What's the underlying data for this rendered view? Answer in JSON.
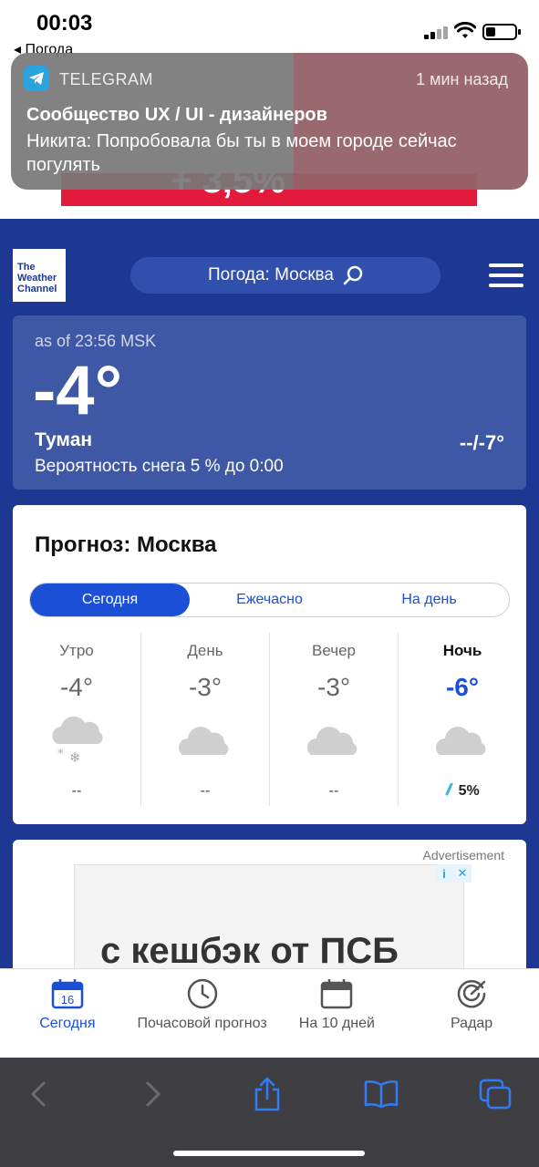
{
  "status_bar": {
    "time": "00:03",
    "back_label": "◂ Погода"
  },
  "notification": {
    "app": "TELEGRAM",
    "time_ago": "1 мин назад",
    "title": "Сообщество UX / UI - дизайнеров",
    "body": "Никита: Попробовала бы ты в моем городе сейчас погулять"
  },
  "top_ad": {
    "text": "+ 3,5%"
  },
  "header": {
    "logo_text": "The Weather Channel",
    "search_label": "Погода: Москва"
  },
  "current": {
    "as_of": "as of 23:56 MSK",
    "temperature": "-4°",
    "condition": "Туман",
    "precip_chance": "Вероятность снега 5 % до 0:00",
    "hi_lo": "--/-7°",
    "icon": "fog-icon"
  },
  "forecast": {
    "title": "Прогноз: Москва",
    "tabs": [
      "Сегодня",
      "Ежечасно",
      "На день"
    ],
    "active_tab": "Сегодня",
    "periods": [
      {
        "name": "Утро",
        "temp": "-4°",
        "icon": "cloud-snow-icon",
        "precip": "--"
      },
      {
        "name": "День",
        "temp": "-3°",
        "icon": "cloud-icon",
        "precip": "--"
      },
      {
        "name": "Вечер",
        "temp": "-3°",
        "icon": "cloud-icon",
        "precip": "--"
      },
      {
        "name": "Ночь",
        "temp": "-6°",
        "icon": "cloud-icon",
        "precip": "5%"
      }
    ]
  },
  "ad": {
    "label": "Advertisement",
    "text": "с кешбэк от ПСБ"
  },
  "tabbar": {
    "items": [
      {
        "label": "Сегодня",
        "icon": "calendar-icon",
        "badge": "16"
      },
      {
        "label": "Почасовой прогноз",
        "icon": "clock-icon"
      },
      {
        "label": "На 10 дней",
        "icon": "calendar-icon"
      },
      {
        "label": "Радар",
        "icon": "radar-icon"
      }
    ]
  },
  "colors": {
    "background": "#1c3893",
    "accent": "#1b4fd6",
    "card": "#3f58a6"
  }
}
